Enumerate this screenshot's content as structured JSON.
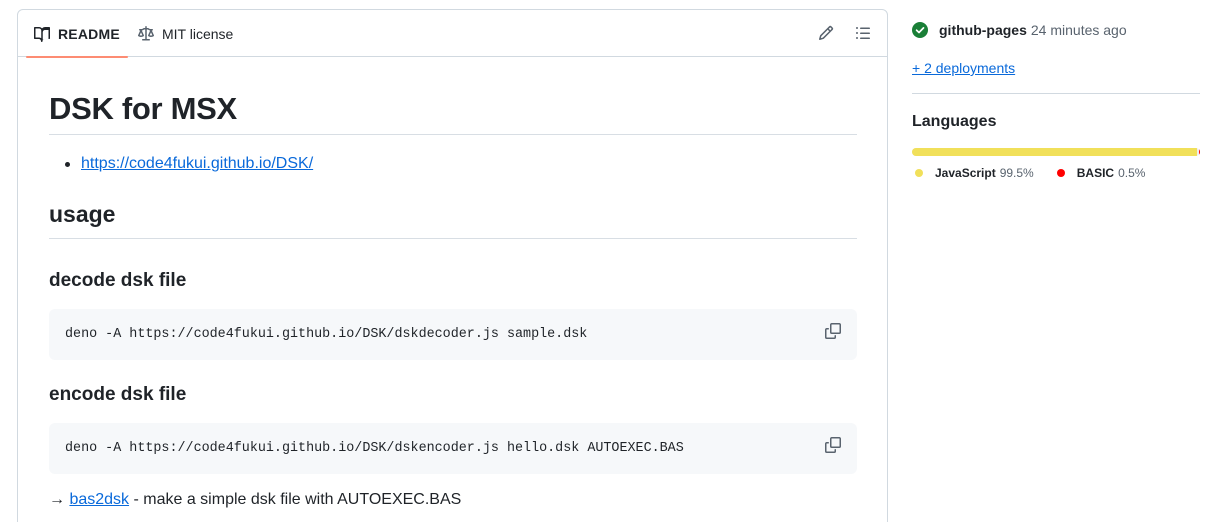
{
  "readme": {
    "tabs": [
      {
        "label": "README",
        "icon": "book-icon"
      },
      {
        "label": "MIT license",
        "icon": "scale-icon"
      }
    ],
    "toolbar": {
      "edit_icon": "pencil-icon",
      "outline_icon": "list-icon"
    },
    "title": "DSK for MSX",
    "links": [
      "https://code4fukui.github.io/DSK/"
    ],
    "usage_heading": "usage",
    "decode_heading": "decode dsk file",
    "decode_command": "deno -A https://code4fukui.github.io/DSK/dskdecoder.js sample.dsk",
    "encode_heading": "encode dsk file",
    "encode_command": "deno -A https://code4fukui.github.io/DSK/dskencoder.js hello.dsk AUTOEXEC.BAS",
    "note_arrow": "→",
    "note_link": "bas2dsk",
    "note_text": " - make a simple dsk file with AUTOEXEC.BAS"
  },
  "sidebar": {
    "deployment": {
      "name": "github-pages",
      "time": "24 minutes ago",
      "status_color": "#1a7f37"
    },
    "more_deployments": "+ 2 deployments",
    "languages_title": "Languages",
    "languages": [
      {
        "name": "JavaScript",
        "percent": "99.5%",
        "value": 99.5,
        "color": "#f1e05a"
      },
      {
        "name": "BASIC",
        "percent": "0.5%",
        "value": 0.5,
        "color": "#ff0000"
      }
    ]
  }
}
